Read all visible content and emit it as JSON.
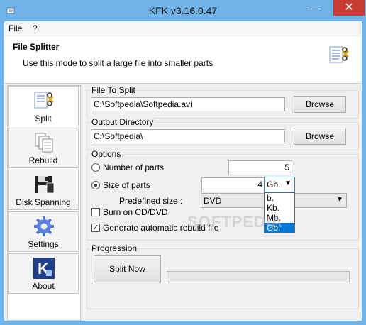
{
  "window": {
    "title": "KFK v3.16.0.47",
    "min": "—",
    "max": "☐",
    "close": "✕"
  },
  "menu": {
    "file": "File",
    "help": "?"
  },
  "header": {
    "title": "File Splitter",
    "subtitle": "Use this mode to split a large file into smaller parts"
  },
  "sidebar": {
    "items": [
      {
        "label": "Split",
        "icon": "split-icon"
      },
      {
        "label": "Rebuild",
        "icon": "rebuild-icon"
      },
      {
        "label": "Disk Spanning",
        "icon": "floppy-disk-icon"
      },
      {
        "label": "Settings",
        "icon": "gear-icon"
      },
      {
        "label": "About",
        "icon": "kfk-logo-icon"
      }
    ]
  },
  "file_to_split": {
    "label": "File To Split",
    "value": "C:\\Softpedia\\Softpedia.avi",
    "browse": "Browse"
  },
  "output_directory": {
    "label": "Output Directory",
    "value": "C:\\Softpedia\\",
    "browse": "Browse"
  },
  "options": {
    "label": "Options",
    "number_of_parts": {
      "label": "Number of parts",
      "value": "5",
      "selected": false
    },
    "size_of_parts": {
      "label": "Size of parts",
      "value": "4",
      "unit": "Gb.",
      "selected": true
    },
    "predefined_size": {
      "label": "Predefined size :",
      "value": "DVD"
    },
    "unit_options": [
      "b.",
      "Kb.",
      "Mb.",
      "Gb."
    ],
    "unit_selected": "Gb.",
    "burn_cd": {
      "label": "Burn on CD/DVD",
      "checked": false
    },
    "generate_rebuild": {
      "label": "Generate automatic rebuild file",
      "checked": true
    }
  },
  "progression": {
    "label": "Progression",
    "split_now": "Split Now",
    "progress": 0
  },
  "watermark": "SOFTPEDIA",
  "colors": {
    "titlebar": "#6fb3e8",
    "close": "#c73b33",
    "selection": "#0078d7"
  }
}
